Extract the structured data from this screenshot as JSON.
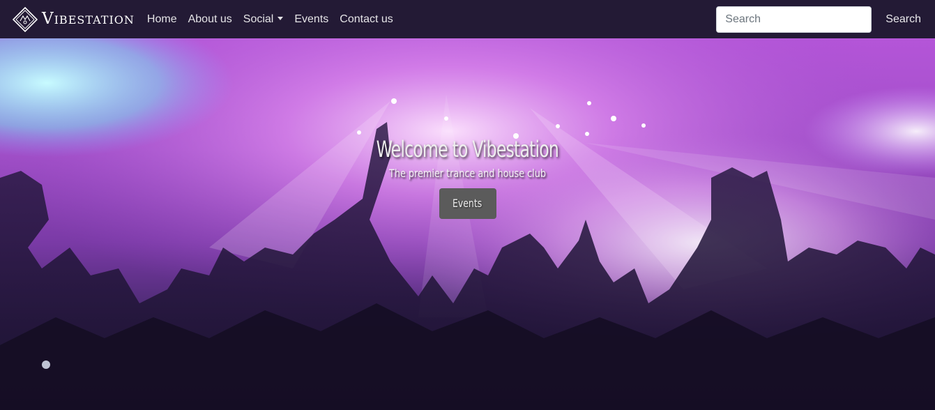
{
  "navbar": {
    "brand_name": "Vibestation",
    "logo_icon": "diamond-logo-icon",
    "links": [
      {
        "label": "Home"
      },
      {
        "label": "About us"
      },
      {
        "label": "Social",
        "dropdown": true
      },
      {
        "label": "Events"
      },
      {
        "label": "Contact us"
      }
    ],
    "search": {
      "placeholder": "Search",
      "value": "",
      "button_label": "Search"
    }
  },
  "hero": {
    "title": "Welcome to Vibestation",
    "subtitle": "The premier trance and house club",
    "button_label": "Events",
    "background": "concert-crowd-image"
  },
  "colors": {
    "navbar_bg": "#231a35",
    "hero_purple": "#b455d8",
    "button_bg": "#5b5b5b"
  }
}
